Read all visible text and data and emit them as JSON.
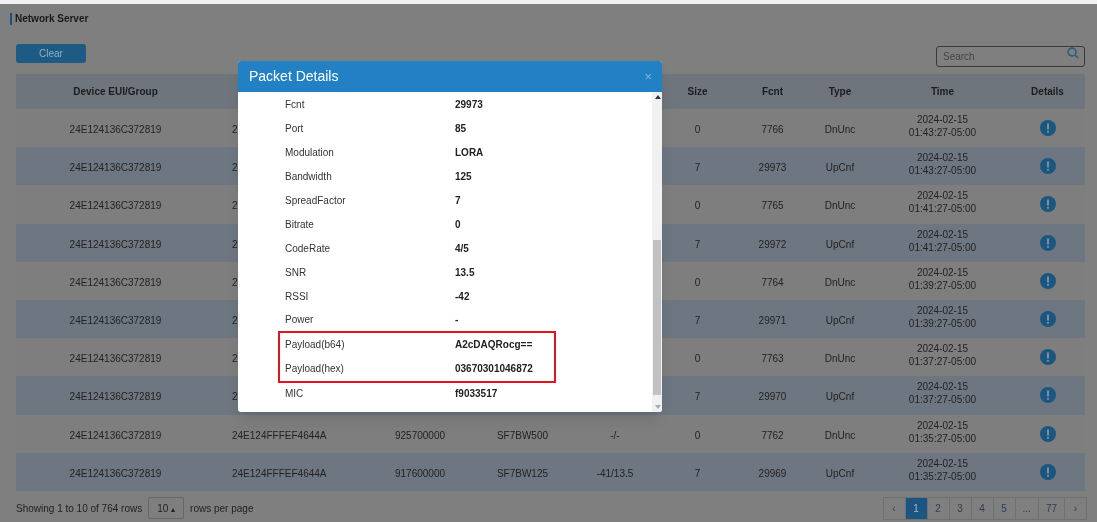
{
  "page": {
    "title": "Network Server"
  },
  "toolbar": {
    "clear_button": "Clear",
    "search": {
      "placeholder": "Search"
    }
  },
  "table": {
    "columns": [
      "Device EUI/Group",
      "",
      "",
      "",
      "",
      "Size",
      "Fcnt",
      "Type",
      "Time",
      "Details"
    ],
    "rows": [
      {
        "device": "24E124136C372819",
        "column_2": "2",
        "size": "0",
        "fcnt": "7766",
        "type": "DnUnc",
        "date": "2024-02-15",
        "time": "01:43:27-05:00"
      },
      {
        "device": "24E124136C372819",
        "column_2": "2",
        "size": "7",
        "fcnt": "29973",
        "type": "UpCnf",
        "date": "2024-02-15",
        "time": "01:43:27-05:00"
      },
      {
        "device": "24E124136C372819",
        "column_2": "2",
        "size": "0",
        "fcnt": "7765",
        "type": "DnUnc",
        "date": "2024-02-15",
        "time": "01:41:27-05:00"
      },
      {
        "device": "24E124136C372819",
        "column_2": "2",
        "size": "7",
        "fcnt": "29972",
        "type": "UpCnf",
        "date": "2024-02-15",
        "time": "01:41:27-05:00"
      },
      {
        "device": "24E124136C372819",
        "column_2": "2",
        "size": "0",
        "fcnt": "7764",
        "type": "DnUnc",
        "date": "2024-02-15",
        "time": "01:39:27-05:00"
      },
      {
        "device": "24E124136C372819",
        "column_2": "2",
        "size": "7",
        "fcnt": "29971",
        "type": "UpCnf",
        "date": "2024-02-15",
        "time": "01:39:27-05:00"
      },
      {
        "device": "24E124136C372819",
        "column_2": "2",
        "size": "0",
        "fcnt": "7763",
        "type": "DnUnc",
        "date": "2024-02-15",
        "time": "01:37:27-05:00"
      },
      {
        "device": "24E124136C372819",
        "column_2": "2",
        "size": "7",
        "fcnt": "29970",
        "type": "UpCnf",
        "date": "2024-02-15",
        "time": "01:37:27-05:00"
      },
      {
        "device": "24E124136C372819",
        "column_2": "24E124FFFEF4644A",
        "column_3": "925700000",
        "column_4": "SF7BW500",
        "column_5": "-/-",
        "size": "0",
        "fcnt": "7762",
        "type": "DnUnc",
        "date": "2024-02-15",
        "time": "01:35:27-05:00"
      },
      {
        "device": "24E124136C372819",
        "column_2": "24E124FFFEF4644A",
        "column_3": "917600000",
        "column_4": "SF7BW125",
        "column_5": "-41/13.5",
        "size": "7",
        "fcnt": "29969",
        "type": "UpCnf",
        "date": "2024-02-15",
        "time": "01:35:27-05:00"
      }
    ]
  },
  "footer": {
    "showing": "Showing 1 to 10 of 764 rows",
    "page_size": "10",
    "page_size_caret": "▴",
    "per_page": "rows per page",
    "pages": [
      {
        "label": "‹",
        "selected": false
      },
      {
        "label": "1",
        "selected": true
      },
      {
        "label": "2",
        "selected": false
      },
      {
        "label": "3",
        "selected": false
      },
      {
        "label": "4",
        "selected": false
      },
      {
        "label": "5",
        "selected": false
      },
      {
        "label": "...",
        "selected": false
      },
      {
        "label": "77",
        "selected": false
      },
      {
        "label": "›",
        "selected": false
      }
    ]
  },
  "dialog": {
    "title": "Packet Details",
    "close": "×",
    "fields": [
      {
        "label": "Fcnt",
        "value": "29973",
        "highlighted": false
      },
      {
        "label": "Port",
        "value": "85",
        "highlighted": false
      },
      {
        "label": "Modulation",
        "value": "LORA",
        "highlighted": false
      },
      {
        "label": "Bandwidth",
        "value": "125",
        "highlighted": false
      },
      {
        "label": "SpreadFactor",
        "value": "7",
        "highlighted": false
      },
      {
        "label": "Bitrate",
        "value": "0",
        "highlighted": false
      },
      {
        "label": "CodeRate",
        "value": "4/5",
        "highlighted": false
      },
      {
        "label": "SNR",
        "value": "13.5",
        "highlighted": false
      },
      {
        "label": "RSSI",
        "value": "-42",
        "highlighted": false
      },
      {
        "label": "Power",
        "value": "-",
        "highlighted": false
      },
      {
        "label": "Payload(b64)",
        "value": "A2cDAQRocg==",
        "highlighted": true
      },
      {
        "label": "Payload(hex)",
        "value": "03670301046872",
        "highlighted": true
      },
      {
        "label": "MIC",
        "value": "f9033517",
        "highlighted": false
      }
    ]
  }
}
